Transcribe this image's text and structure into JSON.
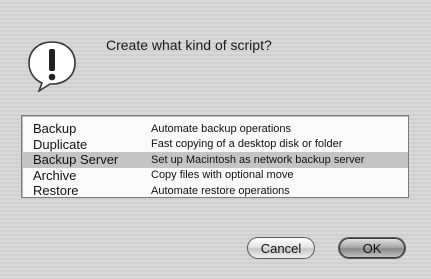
{
  "dialog": {
    "prompt": "Create what kind of script?",
    "icon": "alert-icon"
  },
  "script_types": [
    {
      "name": "Backup",
      "description": "Automate backup operations",
      "selected": false
    },
    {
      "name": "Duplicate",
      "description": "Fast copying of a desktop disk or folder",
      "selected": false
    },
    {
      "name": "Backup Server",
      "description": "Set up Macintosh as network backup server",
      "selected": true
    },
    {
      "name": "Archive",
      "description": "Copy files with optional move",
      "selected": false
    },
    {
      "name": "Restore",
      "description": "Automate restore operations",
      "selected": false
    }
  ],
  "buttons": {
    "cancel": "Cancel",
    "ok": "OK"
  }
}
